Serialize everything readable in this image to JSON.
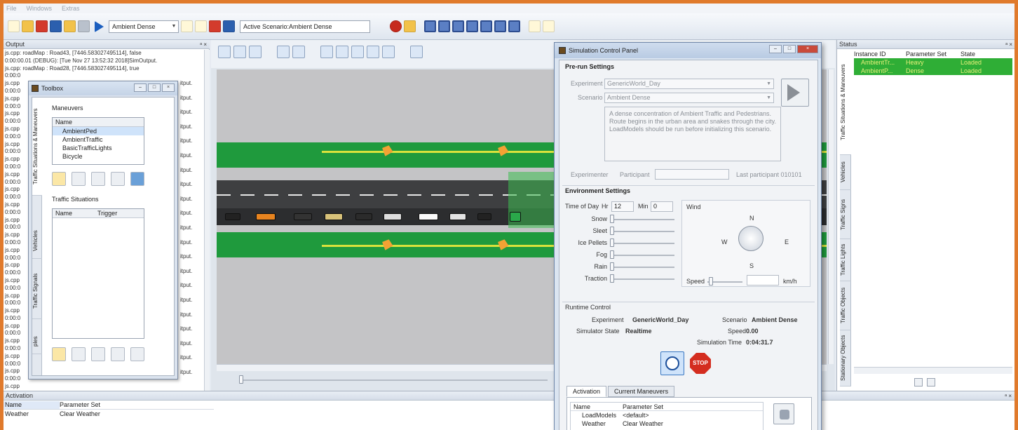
{
  "menu": [
    "File",
    "Windows",
    "Extras"
  ],
  "toolbar": {
    "scenario_select": "Ambient Dense",
    "active_scenario": "Active Scenario:Ambient Dense"
  },
  "output": {
    "title": "Output",
    "pin": "ᵃ ×",
    "lines": [
      "js.cpp: roadMap : Road43, [7446.583027495114], false",
      "0:00:00.01 (DEBUG): [Tue Nov 27 13:52:32 2018]SimOutput.",
      "js.cpp: roadMap : Road28, [7446.583027495114], true",
      "0:00:0",
      "js.cpp",
      "0:00:0",
      "js.cpp",
      "0:00:0",
      "js.cpp",
      "0:00:0",
      "js.cpp",
      "0:00:0",
      "js.cpp",
      "0:00:0",
      "js.cpp",
      "0:00:0",
      "js.cpp",
      "0:00:0",
      "js.cpp",
      "0:00:0",
      "js.cpp",
      "0:00:0",
      "js.cpp",
      "0:00:0",
      "js.cpp",
      "0:00:0",
      "js.cpp",
      "0:00:0",
      "js.cpp",
      "0:00:0",
      "js.cpp",
      "0:00:0",
      "js.cpp",
      "0:00:0",
      "js.cpp",
      "0:00:0",
      "js.cpp",
      "0:00:0",
      "js.cpp",
      "0:00:0",
      "js.cpp",
      "0:00:0",
      "js.cpp",
      "0:00:0",
      "js.cpp",
      "113.09",
      "0:00:0",
      "js.cpp: failed to connect : 102.16904500000002 with",
      "113.09356143050622"
    ],
    "right_frag": [
      "itput.",
      "itput.",
      "itput.",
      "itput.",
      "itput.",
      "itput.",
      "itput.",
      "itput.",
      "itput.",
      "itput.",
      "itput.",
      "itput.",
      "itput.",
      "itput.",
      "itput.",
      "itput.",
      "itput.",
      "itput.",
      "itput.",
      "itput.",
      "itput."
    ]
  },
  "toolbox": {
    "title": "Toolbox",
    "maneuvers_label": "Maneuvers",
    "maneuvers_header": "Name",
    "maneuvers": [
      "AmbientPed",
      "AmbientTraffic",
      "BasicTrafficLights",
      "Bicycle"
    ],
    "traffic_label": "Traffic Situations",
    "traffic_cols": [
      "Name",
      "Trigger"
    ],
    "vtabs": [
      "Traffic Situations & Maneuvers",
      "Vehicles",
      "Traffic Signals",
      "ples"
    ]
  },
  "simpanel": {
    "title": "Simulation Control Panel",
    "prerun": "Pre-run Settings",
    "experiment_label": "Experiment",
    "experiment_value": "GenericWorld_Day",
    "scenario_label": "Scenario",
    "scenario_value": "Ambient Dense",
    "description": "A dense concentration of Ambient Traffic and Pedestrians. Route begins in the urban area and snakes through the city. LoadModels should be run before initializing this scenario.",
    "experimenter_label": "Experimenter",
    "participant_label": "Participant",
    "last_participant": "Last participant  010101",
    "env": "Environment Settings",
    "timeofday": "Time of Day",
    "hr_label": "Hr",
    "hr_value": "12",
    "min_label": "Min",
    "min_value": "0",
    "weather": [
      "Snow",
      "Sleet",
      "Ice Pellets",
      "Fog",
      "Rain",
      "Traction"
    ],
    "wind_label": "Wind",
    "compass": {
      "n": "N",
      "s": "S",
      "e": "E",
      "w": "W"
    },
    "speed_label": "Speed",
    "speed_unit": "km/h",
    "runtime": "Runtime Control",
    "rt_experiment_label": "Experiment",
    "rt_experiment_value": "GenericWorld_Day",
    "rt_scenario_label": "Scenario",
    "rt_scenario_value": "Ambient Dense",
    "rt_state_label": "Simulator State",
    "rt_state_value": "Realtime",
    "rt_speed_label": "Speed",
    "rt_speed_value": "0.00",
    "rt_simtime_label": "Simulation Time",
    "rt_simtime_value": "0:04:31.7",
    "stop_label": "STOP",
    "tabs": [
      "Activation",
      "Current Maneuvers"
    ],
    "act_cols": [
      "Name",
      "Parameter Set"
    ],
    "act_rows": [
      [
        "LoadModels",
        "<default>"
      ],
      [
        "Weather",
        "Clear Weather"
      ]
    ]
  },
  "status": {
    "title": "Status",
    "pin": "ᵃ ×",
    "cols": [
      "Instance ID",
      "Parameter Set",
      "State"
    ],
    "rows": [
      [
        "AmbientTr...",
        "Heavy",
        "Loaded"
      ],
      [
        "AmbientP...",
        "Dense",
        "Loaded"
      ]
    ],
    "vtabs": [
      "Traffic Situations & Maneuvers",
      "Vehicles",
      "Traffic Signs",
      "Traffic Lights",
      "Traffic Objects",
      "Stationary Objects"
    ]
  },
  "activation": {
    "title": "Activation",
    "pin": "ᵃ ×",
    "cols": [
      "Name",
      "Parameter Set"
    ],
    "row": [
      "Weather",
      "Clear Weather"
    ]
  },
  "colors": {
    "frame": "#e07a2c",
    "grass": "#1f9a3d",
    "road": "#48494b",
    "status_green": "#2fae36"
  }
}
